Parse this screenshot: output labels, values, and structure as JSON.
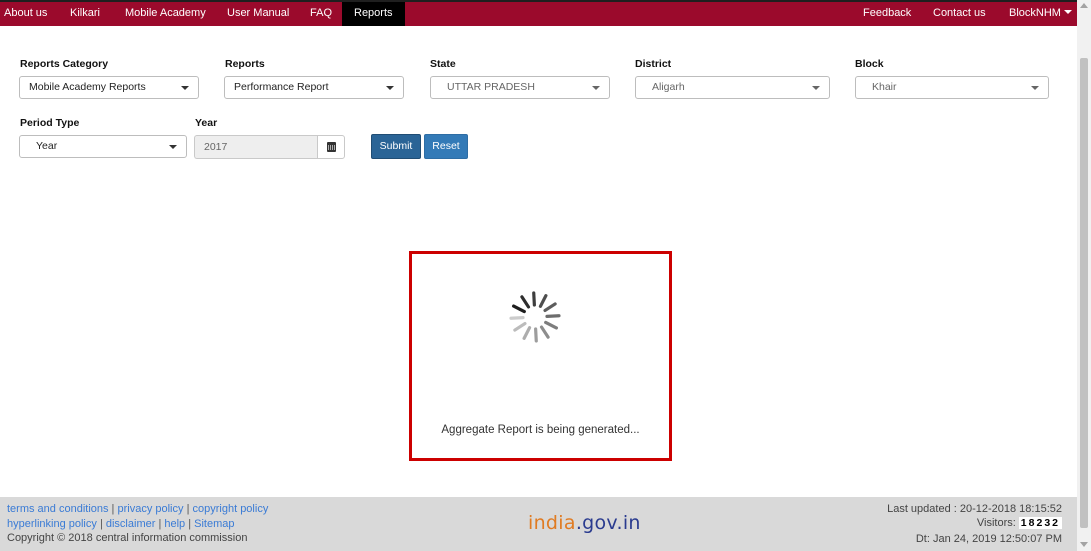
{
  "nav": {
    "left_items": [
      "About us",
      "Kilkari",
      "Mobile Academy",
      "User Manual",
      "FAQ",
      "Reports"
    ],
    "active_item": "Reports",
    "right_items": [
      "Feedback",
      "Contact us",
      "BlockNHM"
    ],
    "colors": {
      "bar": "#9b0a2c",
      "active": "#000000"
    }
  },
  "form": {
    "reports_category": {
      "label": "Reports Category",
      "value": "Mobile Academy Reports"
    },
    "reports": {
      "label": "Reports",
      "value": "Performance Report"
    },
    "state": {
      "label": "State",
      "value": "UTTAR PRADESH"
    },
    "district": {
      "label": "District",
      "value": "Aligarh"
    },
    "block": {
      "label": "Block",
      "value": "Khair"
    },
    "period_type": {
      "label": "Period Type",
      "value": "Year"
    },
    "year": {
      "label": "Year",
      "value": "2017"
    },
    "submit_label": "Submit",
    "reset_label": "Reset"
  },
  "loading": {
    "message": "Aggregate Report is being generated...",
    "icon": "spinner-icon",
    "border_color": "#cc0000"
  },
  "footer": {
    "links_line1": [
      "terms and conditions",
      "privacy policy",
      "copyright policy"
    ],
    "links_line2": [
      "hyperlinking policy",
      "disclaimer",
      "help",
      "Sitemap"
    ],
    "copyright": "Copyright © 2018 central information commission",
    "logo_part1": "india",
    "logo_part2": ".gov.in",
    "last_updated": "Last updated : 20-12-2018 18:15:52",
    "visitors_label": "Visitors:",
    "visitors_count": "18232",
    "date_time": "Dt: Jan 24, 2019 12:50:07 PM"
  }
}
